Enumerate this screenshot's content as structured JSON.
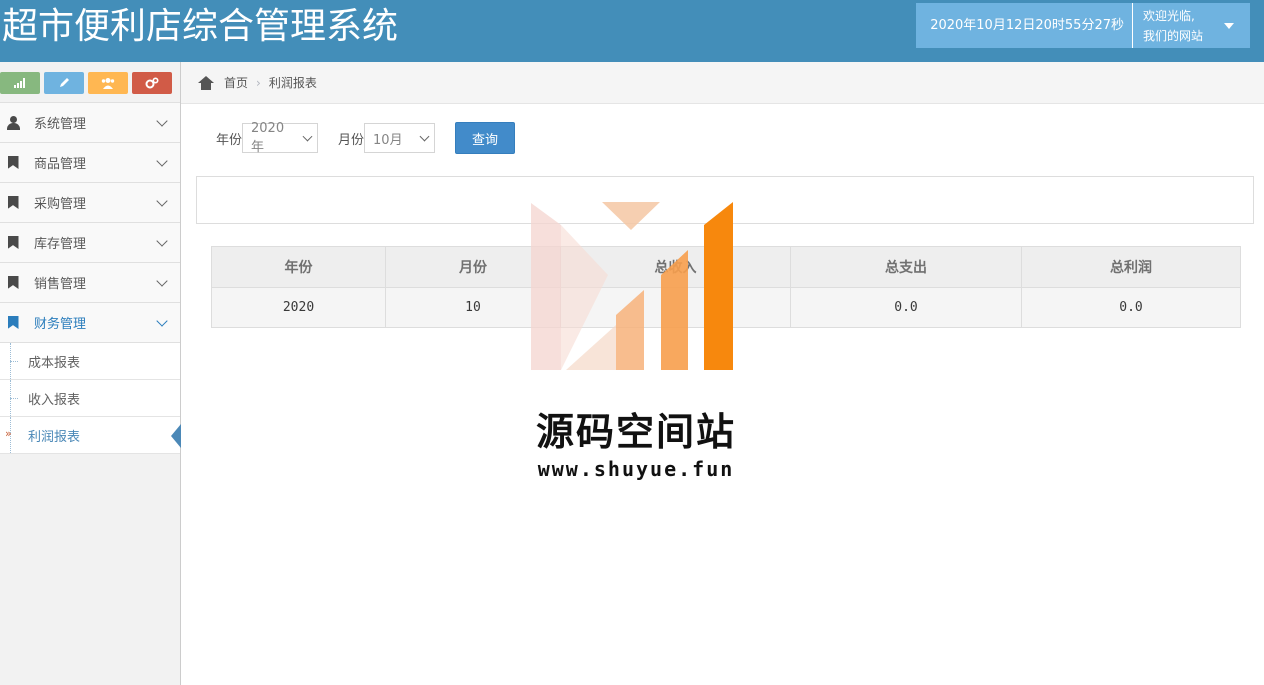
{
  "app": {
    "title": "超市便利店综合管理系统",
    "datetime": "2020年10月12日20时55分27秒",
    "welcome_line1": "欢迎光临,",
    "welcome_line2": "我们的网站"
  },
  "sidebar": {
    "shortcuts": [
      {
        "icon": "signal-icon",
        "color": "#87b87f"
      },
      {
        "icon": "pencil-icon",
        "color": "#6fb3e0"
      },
      {
        "icon": "users-icon",
        "color": "#ffb752"
      },
      {
        "icon": "cogs-icon",
        "color": "#d15b47"
      }
    ],
    "items": [
      {
        "label": "系统管理",
        "icon": "user-icon"
      },
      {
        "label": "商品管理",
        "icon": "bookmark-icon"
      },
      {
        "label": "采购管理",
        "icon": "bookmark-icon"
      },
      {
        "label": "库存管理",
        "icon": "bookmark-icon"
      },
      {
        "label": "销售管理",
        "icon": "bookmark-icon"
      },
      {
        "label": "财务管理",
        "icon": "bookmark-icon"
      }
    ],
    "submenu": [
      {
        "label": "成本报表"
      },
      {
        "label": "收入报表"
      },
      {
        "label": "利润报表"
      }
    ]
  },
  "breadcrumb": {
    "home": "首页",
    "current": "利润报表"
  },
  "filter": {
    "year_label": "年份",
    "year_value": "2020年",
    "month_label": "月份",
    "month_value": "10月",
    "query_button": "查询"
  },
  "table": {
    "headers": [
      "年份",
      "月份",
      "总收入",
      "总支出",
      "总利润"
    ],
    "rows": [
      [
        "2020",
        "10",
        "",
        "0.0",
        "0.0"
      ]
    ]
  },
  "watermark": {
    "name": "源码空间站",
    "url": "www.shuyue.fun"
  },
  "colors": {
    "navbar": "#438eb9",
    "accent": "#428bca"
  }
}
